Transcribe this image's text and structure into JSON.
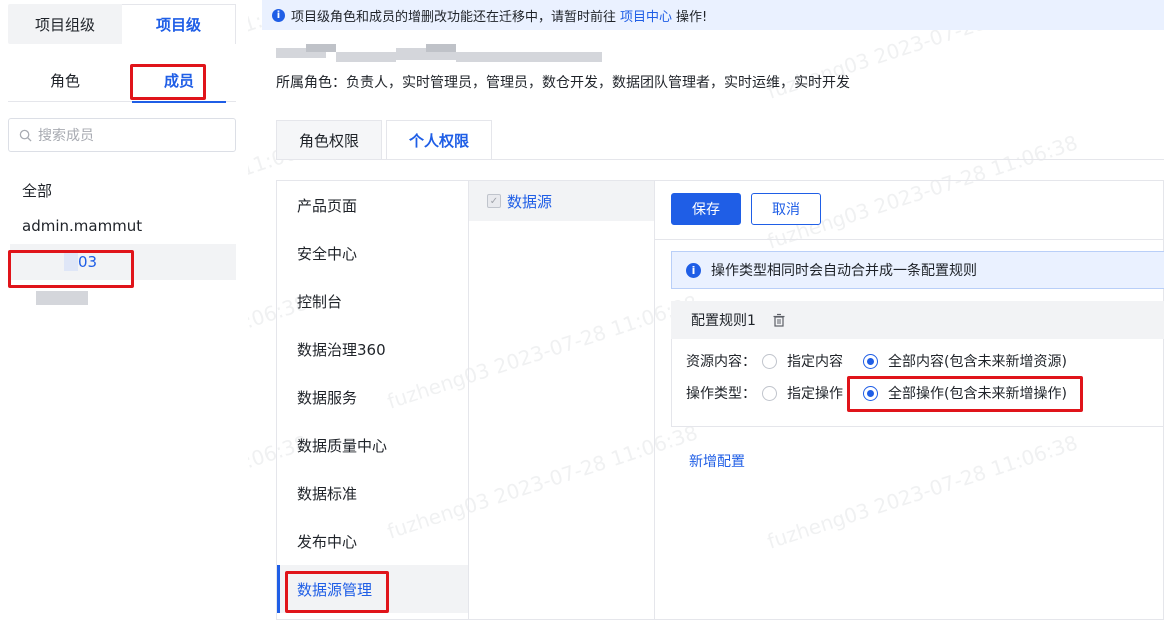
{
  "left": {
    "level_tabs": [
      "项目组级",
      "项目级"
    ],
    "sub_tabs": [
      "角色",
      "成员"
    ],
    "search_placeholder": "搜索成员",
    "members": [
      "全部",
      "admin.mammut",
      "03"
    ]
  },
  "notice": {
    "text_before": "项目级角色和成员的增删改功能还在迁移中，请暂时前往",
    "link": "项目中心",
    "text_after": "操作!"
  },
  "member_roles": "所属角色：负责人，实时管理员，管理员，数仓开发，数据团队管理者，实时运维，实时开发",
  "perm_tabs": [
    "角色权限",
    "个人权限"
  ],
  "categories": [
    "产品页面",
    "安全中心",
    "控制台",
    "数据治理360",
    "数据服务",
    "数据质量中心",
    "数据标准",
    "发布中心",
    "数据源管理"
  ],
  "resources": [
    "数据源"
  ],
  "config": {
    "save": "保存",
    "cancel": "取消",
    "tip": "操作类型相同时会自动合并成一条配置规则",
    "rule_title": "配置规则1",
    "resource_label": "资源内容：",
    "resource_opt1": "指定内容",
    "resource_opt2": "全部内容(包含未来新增资源)",
    "op_label": "操作类型：",
    "op_opt1": "指定操作",
    "op_opt2": "全部操作(包含未来新增操作)",
    "add": "新增配置"
  },
  "watermark": "fuzheng03 2023-07-28 11:06:38",
  "colors": {
    "accent": "#1f5ee6",
    "highlight": "#e0141a"
  }
}
